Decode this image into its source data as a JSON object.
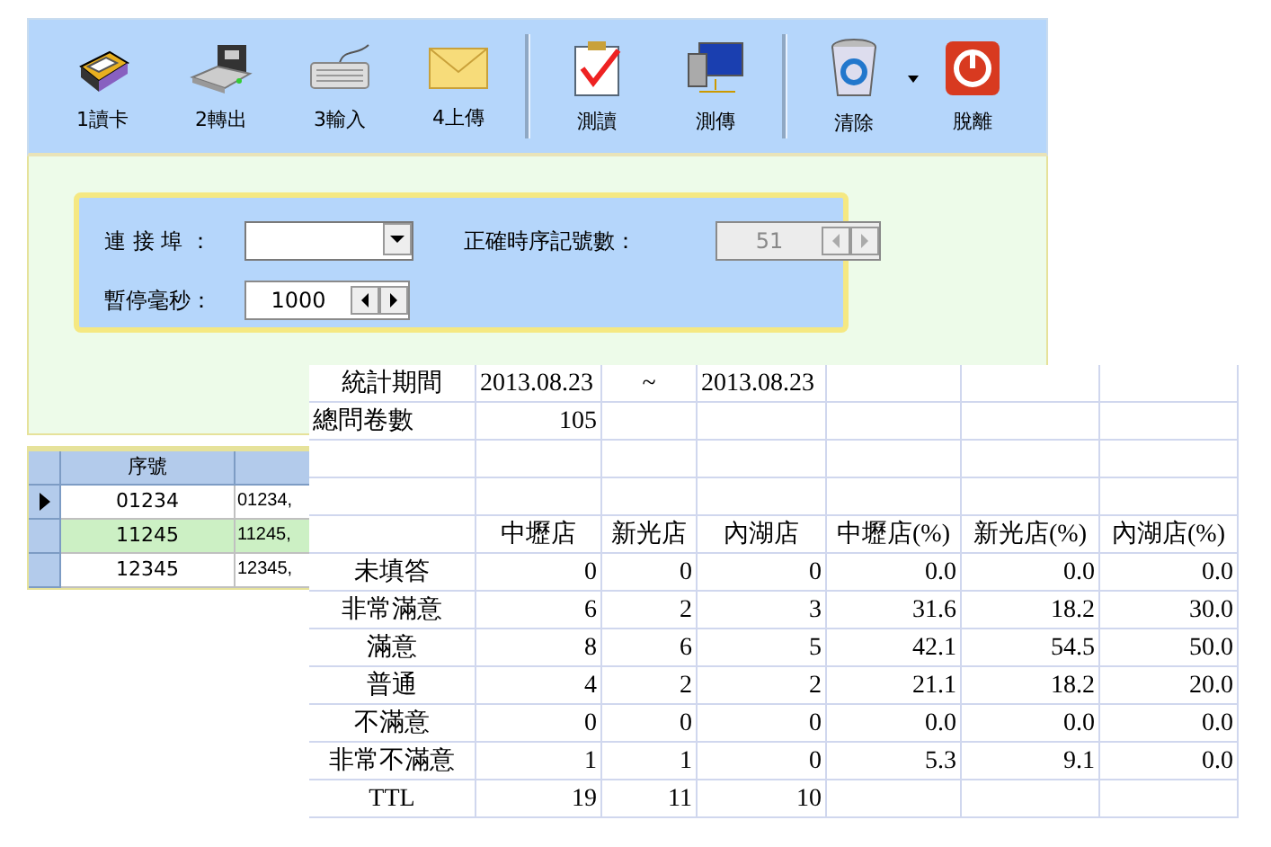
{
  "toolbar": {
    "groups": [
      {
        "buttons": [
          {
            "label": "1讀卡",
            "has_menu": false
          },
          {
            "label": "2轉出",
            "has_menu": false
          },
          {
            "label": "3輸入",
            "has_menu": false
          },
          {
            "label": "4上傳",
            "has_menu": false
          }
        ]
      },
      {
        "buttons": [
          {
            "label": "測讀",
            "has_menu": false
          },
          {
            "label": "測傳",
            "has_menu": false
          }
        ]
      },
      {
        "buttons": [
          {
            "label": "清除",
            "has_menu": true
          },
          {
            "label": "脫離",
            "has_menu": false
          }
        ]
      }
    ]
  },
  "settings": {
    "port": {
      "label": "連 接 埠 ："
    },
    "pause": {
      "label": "暫停毫秒：",
      "value": "1000",
      "disabled": false
    },
    "count": {
      "label": "正確時序記號數：",
      "value": "51",
      "disabled": true
    }
  },
  "grid": {
    "columns": [
      "序號"
    ],
    "rows": [
      {
        "cells": [
          "01234",
          "01234,"
        ],
        "current": true,
        "selected": false
      },
      {
        "cells": [
          "11245",
          "11245,"
        ],
        "current": false,
        "selected": true
      },
      {
        "cells": [
          "12345",
          "12345,"
        ],
        "current": false,
        "selected": false
      }
    ]
  },
  "sheet": {
    "rows": [
      {
        "kind": "title",
        "cells": [
          "統計期間",
          "2013.08.23",
          "~",
          "2013.08.23",
          null,
          null,
          null
        ]
      },
      {
        "kind": "left",
        "cells": [
          "總問卷數",
          "105",
          null,
          null,
          null,
          null,
          null
        ]
      },
      {
        "kind": "blank",
        "cells": [
          null,
          null,
          null,
          null,
          null,
          null,
          null
        ]
      },
      {
        "kind": "blank",
        "cells": [
          null,
          null,
          null,
          null,
          null,
          null,
          null
        ]
      },
      {
        "kind": "header",
        "cells": [
          null,
          "中壢店",
          "新光店",
          "內湖店",
          "中壢店(%)",
          "新光店(%)",
          "內湖店(%)"
        ]
      },
      {
        "kind": "data",
        "cells": [
          "未填答",
          "0",
          "0",
          "0",
          "0.0",
          "0.0",
          "0.0"
        ]
      },
      {
        "kind": "data",
        "cells": [
          "非常滿意",
          "6",
          "2",
          "3",
          "31.6",
          "18.2",
          "30.0"
        ]
      },
      {
        "kind": "data",
        "cells": [
          "滿意",
          "8",
          "6",
          "5",
          "42.1",
          "54.5",
          "50.0"
        ]
      },
      {
        "kind": "data",
        "cells": [
          "普通",
          "4",
          "2",
          "2",
          "21.1",
          "18.2",
          "20.0"
        ]
      },
      {
        "kind": "data",
        "cells": [
          "不滿意",
          "0",
          "0",
          "0",
          "0.0",
          "0.0",
          "0.0"
        ]
      },
      {
        "kind": "data",
        "cells": [
          "非常不滿意",
          "1",
          "1",
          "0",
          "5.3",
          "9.1",
          "0.0"
        ]
      },
      {
        "kind": "data",
        "cells": [
          "TTL",
          "19",
          "11",
          "10",
          null,
          null,
          null
        ]
      }
    ]
  }
}
